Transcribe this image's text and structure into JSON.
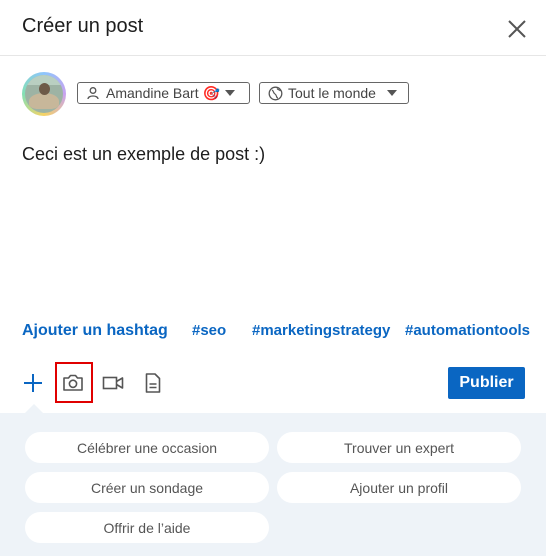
{
  "header": {
    "title": "Créer un post",
    "close_icon": "close-icon"
  },
  "author": {
    "name": "Amandine Bart 🎯",
    "icon": "person-icon",
    "dropdown_icon": "caret-down-icon"
  },
  "audience": {
    "label": "Tout le monde",
    "icon": "globe-icon",
    "dropdown_icon": "caret-down-icon"
  },
  "post": {
    "text": "Ceci est un exemple de post :)"
  },
  "hashtags": {
    "add_label": "Ajouter un hashtag",
    "suggestions": [
      "#seo",
      "#marketingstrategy",
      "#automationtools"
    ]
  },
  "toolbar": {
    "add_icon": "plus-icon",
    "photo_icon": "camera-icon",
    "video_icon": "video-icon",
    "document_icon": "document-icon",
    "publish_label": "Publier"
  },
  "options": [
    "Célébrer une occasion",
    "Trouver un expert",
    "Créer un sondage",
    "Ajouter un profil",
    "Offrir de l’aide"
  ],
  "colors": {
    "accent": "#0a66c2",
    "highlight": "#e00000",
    "panel": "#eef3f8"
  }
}
